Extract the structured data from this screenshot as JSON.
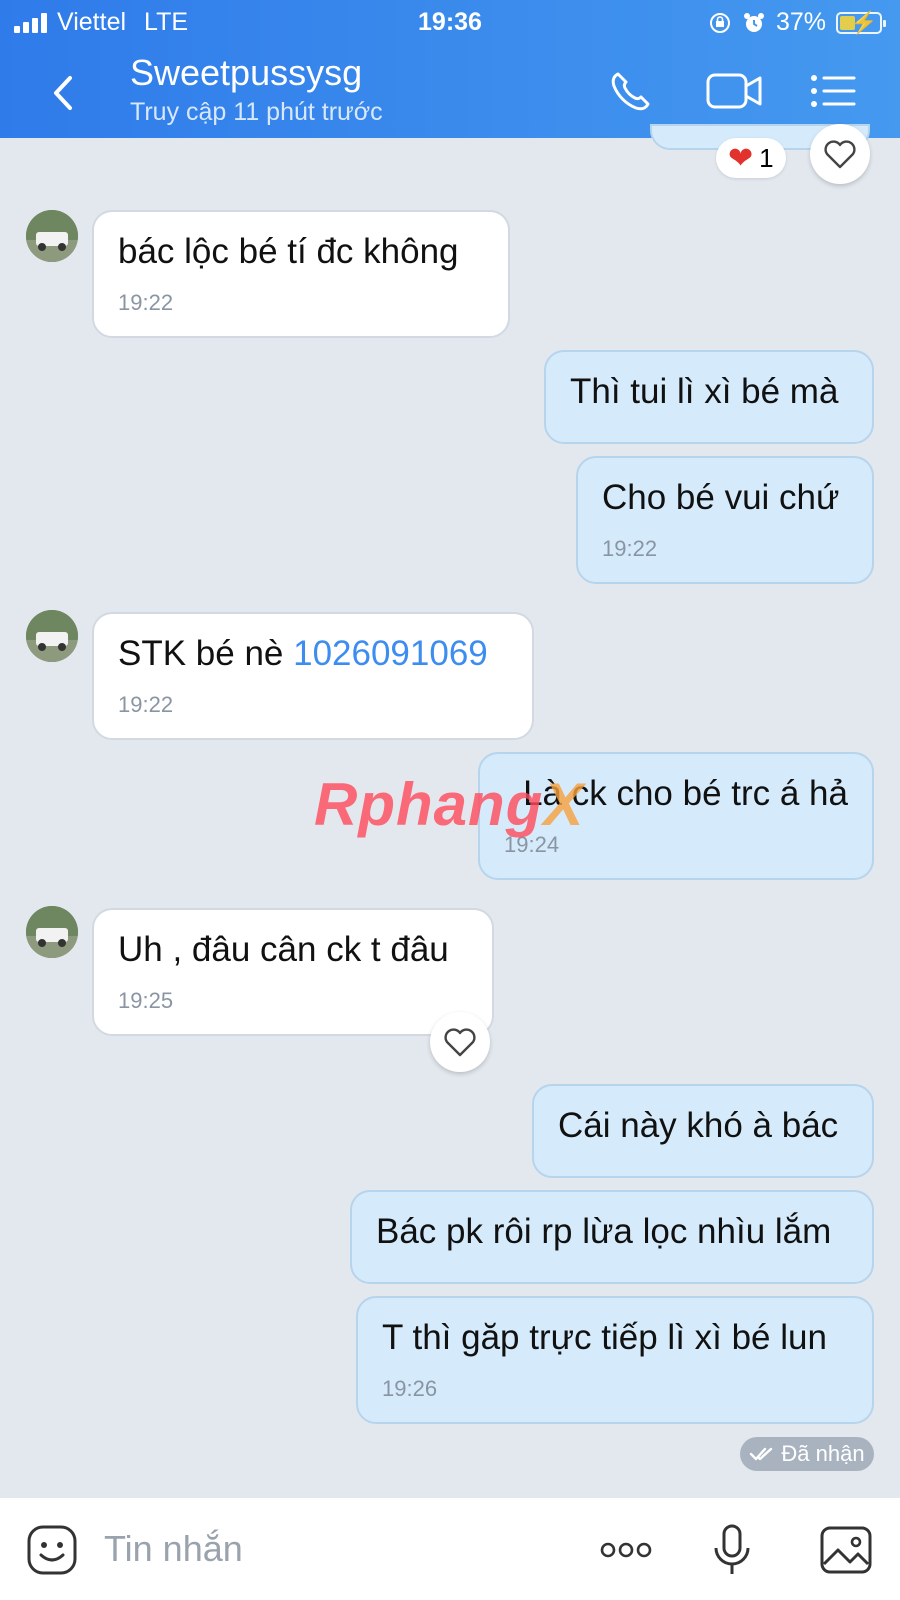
{
  "status_bar": {
    "carrier": "Viettel",
    "network": "LTE",
    "time": "19:36",
    "battery": "37%"
  },
  "header": {
    "title": "Sweetpussysg",
    "subtitle": "Truy cập 11 phút trước"
  },
  "reaction_top": {
    "count": "1"
  },
  "messages": [
    {
      "text": "bác lộc bé tí đc không",
      "time": "19:22"
    },
    {
      "text": "Thì tui lì xì bé mà"
    },
    {
      "text": "Cho bé vui chứ",
      "time": "19:22"
    },
    {
      "text_prefix": "STK bé nè ",
      "link": "1026091069",
      "time": "19:22"
    },
    {
      "text": "Là ck cho bé trc á hả",
      "time": "19:24"
    },
    {
      "text": "Uh , đâu cân ck t đâu",
      "time": "19:25"
    },
    {
      "text": "Cái này khó à bác"
    },
    {
      "text": "Bác pk rôi rp lừa lọc nhìu lắm"
    },
    {
      "text": "T thì găp trực tiếp lì xì bé lun",
      "time": "19:26"
    }
  ],
  "delivery_status": "Đã nhận",
  "watermark": {
    "main": "Rphang",
    "accent": "X"
  },
  "composer": {
    "placeholder": "Tin nhắn"
  },
  "colors": {
    "header": "#2f7bea",
    "outgoing_bubble": "#d5ebfb",
    "incoming_bubble": "#ffffff",
    "link": "#3d8df0"
  }
}
